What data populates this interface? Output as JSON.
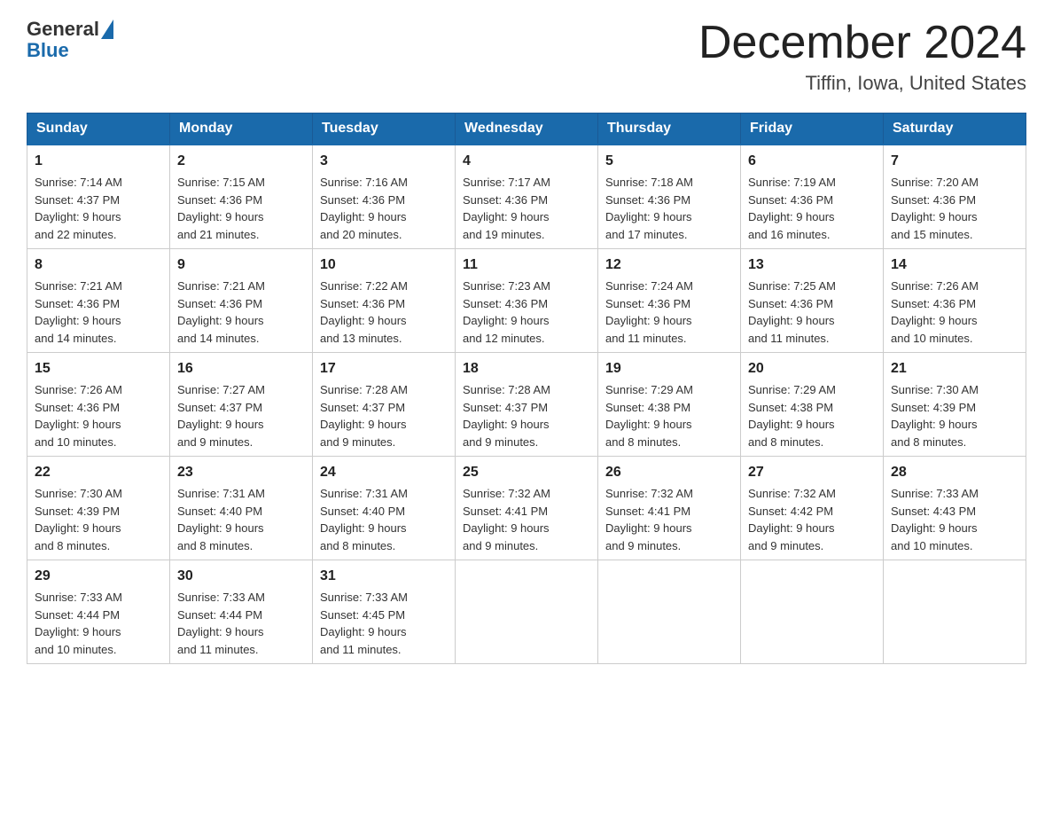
{
  "header": {
    "logo_general": "General",
    "logo_blue": "Blue",
    "month_title": "December 2024",
    "location": "Tiffin, Iowa, United States"
  },
  "weekdays": [
    "Sunday",
    "Monday",
    "Tuesday",
    "Wednesday",
    "Thursday",
    "Friday",
    "Saturday"
  ],
  "weeks": [
    [
      {
        "day": "1",
        "sunrise": "7:14 AM",
        "sunset": "4:37 PM",
        "daylight": "9 hours and 22 minutes."
      },
      {
        "day": "2",
        "sunrise": "7:15 AM",
        "sunset": "4:36 PM",
        "daylight": "9 hours and 21 minutes."
      },
      {
        "day": "3",
        "sunrise": "7:16 AM",
        "sunset": "4:36 PM",
        "daylight": "9 hours and 20 minutes."
      },
      {
        "day": "4",
        "sunrise": "7:17 AM",
        "sunset": "4:36 PM",
        "daylight": "9 hours and 19 minutes."
      },
      {
        "day": "5",
        "sunrise": "7:18 AM",
        "sunset": "4:36 PM",
        "daylight": "9 hours and 17 minutes."
      },
      {
        "day": "6",
        "sunrise": "7:19 AM",
        "sunset": "4:36 PM",
        "daylight": "9 hours and 16 minutes."
      },
      {
        "day": "7",
        "sunrise": "7:20 AM",
        "sunset": "4:36 PM",
        "daylight": "9 hours and 15 minutes."
      }
    ],
    [
      {
        "day": "8",
        "sunrise": "7:21 AM",
        "sunset": "4:36 PM",
        "daylight": "9 hours and 14 minutes."
      },
      {
        "day": "9",
        "sunrise": "7:21 AM",
        "sunset": "4:36 PM",
        "daylight": "9 hours and 14 minutes."
      },
      {
        "day": "10",
        "sunrise": "7:22 AM",
        "sunset": "4:36 PM",
        "daylight": "9 hours and 13 minutes."
      },
      {
        "day": "11",
        "sunrise": "7:23 AM",
        "sunset": "4:36 PM",
        "daylight": "9 hours and 12 minutes."
      },
      {
        "day": "12",
        "sunrise": "7:24 AM",
        "sunset": "4:36 PM",
        "daylight": "9 hours and 11 minutes."
      },
      {
        "day": "13",
        "sunrise": "7:25 AM",
        "sunset": "4:36 PM",
        "daylight": "9 hours and 11 minutes."
      },
      {
        "day": "14",
        "sunrise": "7:26 AM",
        "sunset": "4:36 PM",
        "daylight": "9 hours and 10 minutes."
      }
    ],
    [
      {
        "day": "15",
        "sunrise": "7:26 AM",
        "sunset": "4:36 PM",
        "daylight": "9 hours and 10 minutes."
      },
      {
        "day": "16",
        "sunrise": "7:27 AM",
        "sunset": "4:37 PM",
        "daylight": "9 hours and 9 minutes."
      },
      {
        "day": "17",
        "sunrise": "7:28 AM",
        "sunset": "4:37 PM",
        "daylight": "9 hours and 9 minutes."
      },
      {
        "day": "18",
        "sunrise": "7:28 AM",
        "sunset": "4:37 PM",
        "daylight": "9 hours and 9 minutes."
      },
      {
        "day": "19",
        "sunrise": "7:29 AM",
        "sunset": "4:38 PM",
        "daylight": "9 hours and 8 minutes."
      },
      {
        "day": "20",
        "sunrise": "7:29 AM",
        "sunset": "4:38 PM",
        "daylight": "9 hours and 8 minutes."
      },
      {
        "day": "21",
        "sunrise": "7:30 AM",
        "sunset": "4:39 PM",
        "daylight": "9 hours and 8 minutes."
      }
    ],
    [
      {
        "day": "22",
        "sunrise": "7:30 AM",
        "sunset": "4:39 PM",
        "daylight": "9 hours and 8 minutes."
      },
      {
        "day": "23",
        "sunrise": "7:31 AM",
        "sunset": "4:40 PM",
        "daylight": "9 hours and 8 minutes."
      },
      {
        "day": "24",
        "sunrise": "7:31 AM",
        "sunset": "4:40 PM",
        "daylight": "9 hours and 8 minutes."
      },
      {
        "day": "25",
        "sunrise": "7:32 AM",
        "sunset": "4:41 PM",
        "daylight": "9 hours and 9 minutes."
      },
      {
        "day": "26",
        "sunrise": "7:32 AM",
        "sunset": "4:41 PM",
        "daylight": "9 hours and 9 minutes."
      },
      {
        "day": "27",
        "sunrise": "7:32 AM",
        "sunset": "4:42 PM",
        "daylight": "9 hours and 9 minutes."
      },
      {
        "day": "28",
        "sunrise": "7:33 AM",
        "sunset": "4:43 PM",
        "daylight": "9 hours and 10 minutes."
      }
    ],
    [
      {
        "day": "29",
        "sunrise": "7:33 AM",
        "sunset": "4:44 PM",
        "daylight": "9 hours and 10 minutes."
      },
      {
        "day": "30",
        "sunrise": "7:33 AM",
        "sunset": "4:44 PM",
        "daylight": "9 hours and 11 minutes."
      },
      {
        "day": "31",
        "sunrise": "7:33 AM",
        "sunset": "4:45 PM",
        "daylight": "9 hours and 11 minutes."
      },
      null,
      null,
      null,
      null
    ]
  ],
  "labels": {
    "sunrise": "Sunrise:",
    "sunset": "Sunset:",
    "daylight": "Daylight:"
  }
}
